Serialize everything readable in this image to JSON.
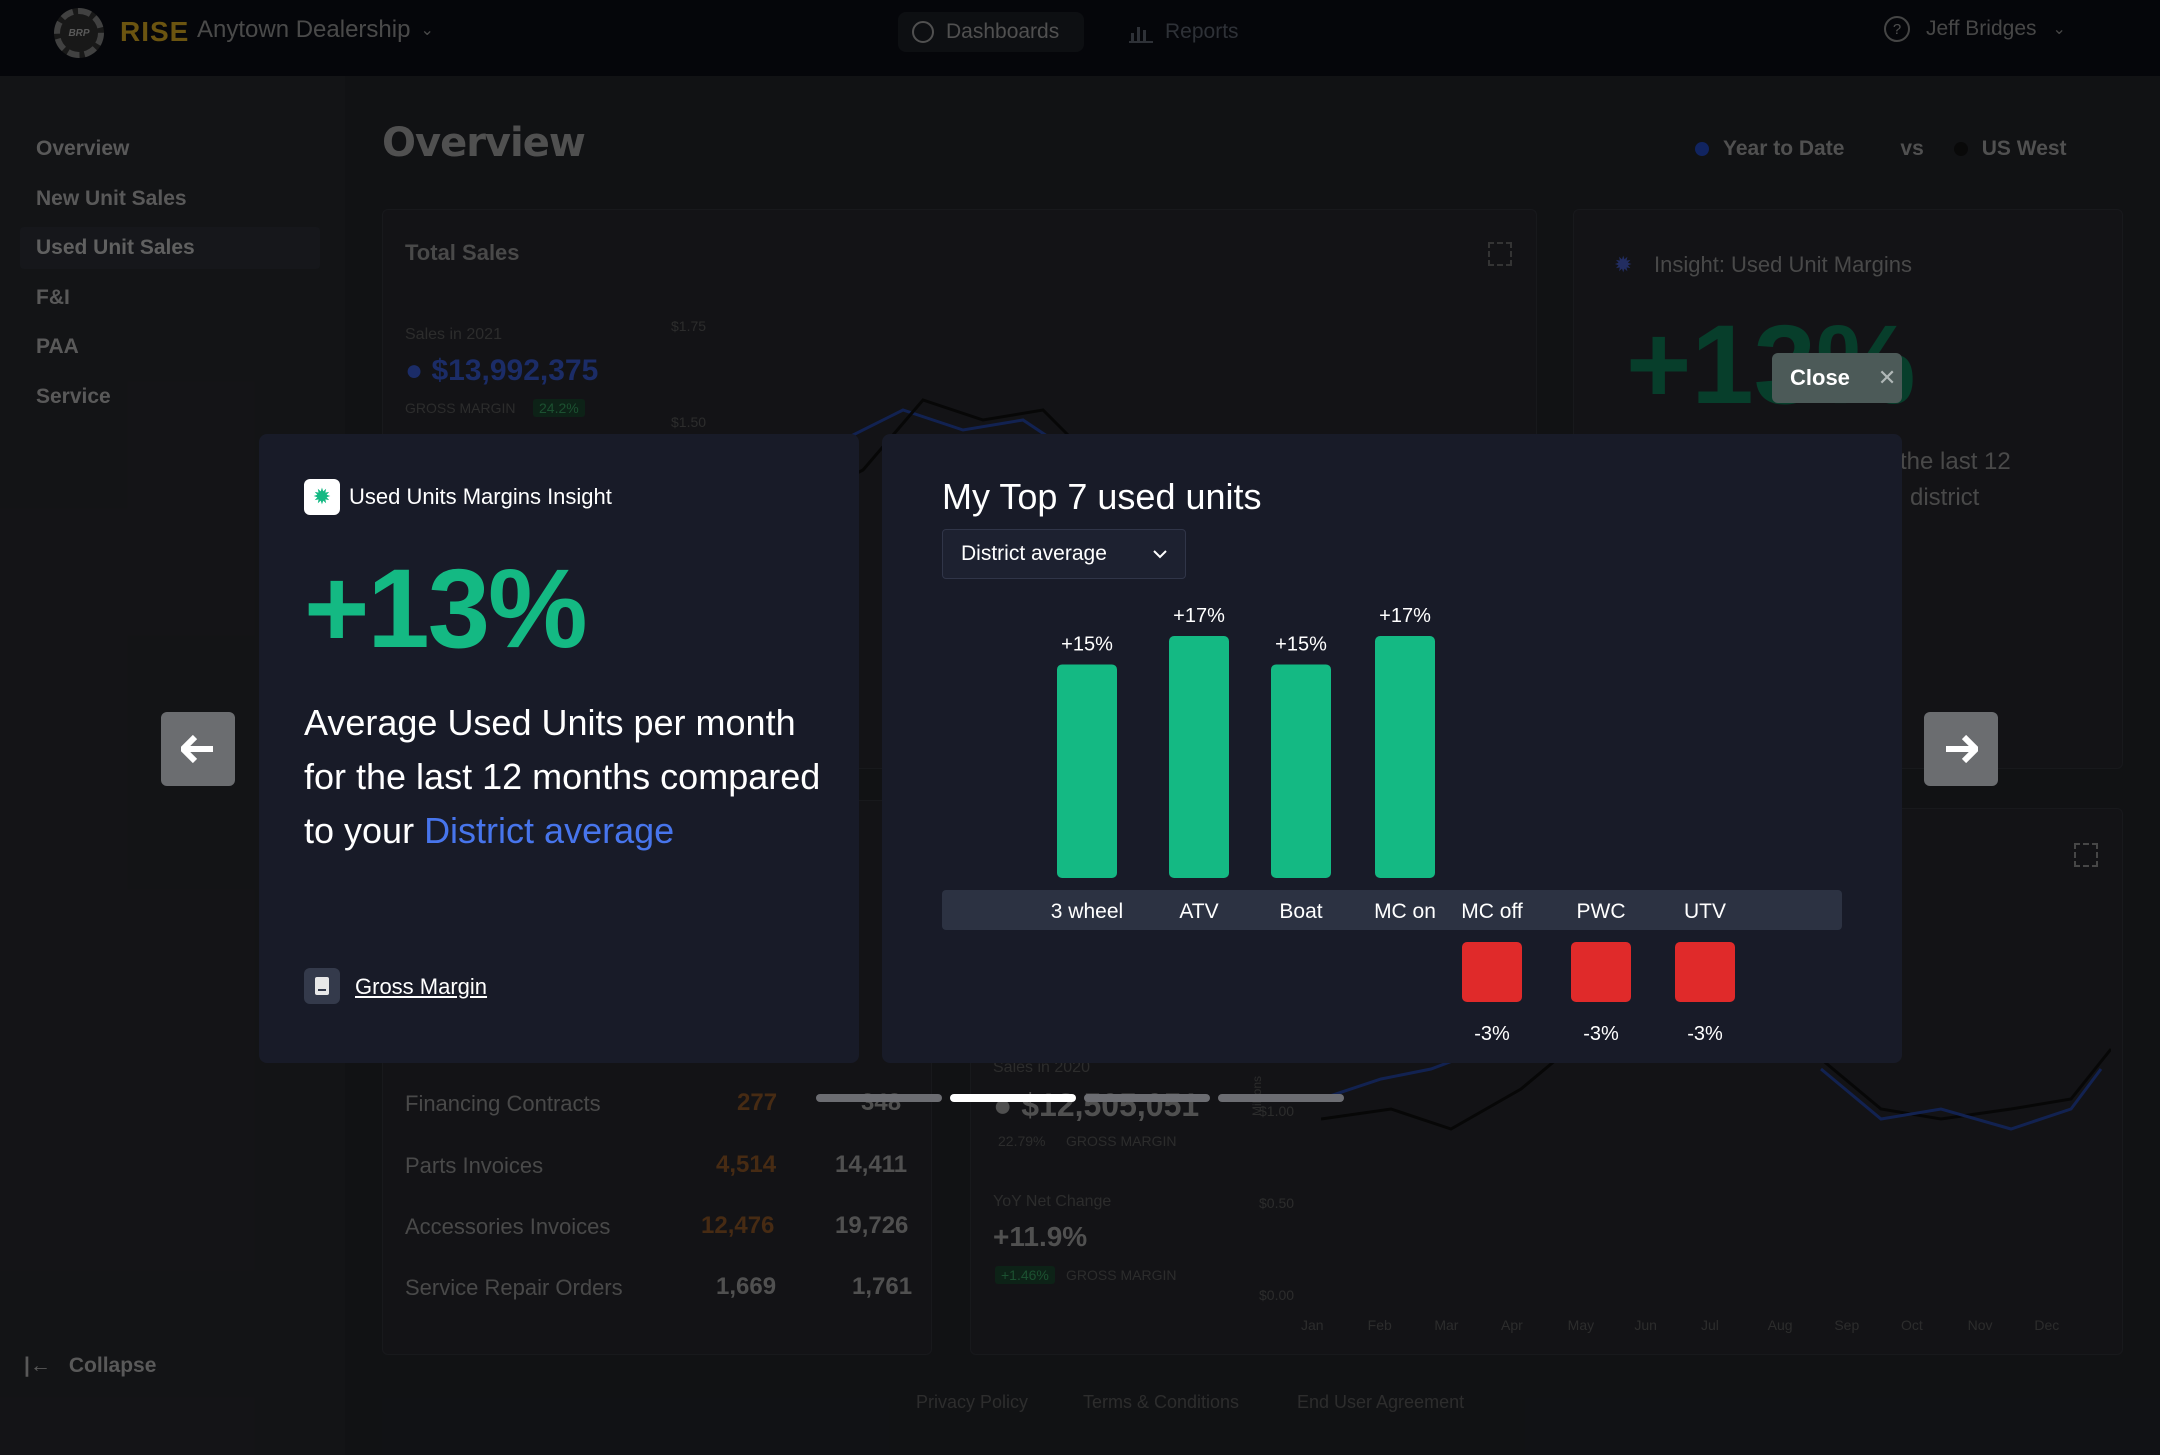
{
  "topbar": {
    "logo_badge": "BRP",
    "logo_text": "RISE",
    "dealership": "Anytown Dealership",
    "nav": [
      {
        "label": "Dashboards",
        "icon": "gauge-icon"
      },
      {
        "label": "Reports",
        "icon": "bar-chart-icon"
      }
    ],
    "user": "Jeff Bridges"
  },
  "sidebar": {
    "items": [
      {
        "label": "Overview",
        "active": false
      },
      {
        "label": "New Unit Sales",
        "active": false
      },
      {
        "label": "Used Unit Sales",
        "active": true
      },
      {
        "label": "F&I",
        "active": false
      },
      {
        "label": "PAA",
        "active": false
      },
      {
        "label": "Service",
        "active": false
      }
    ],
    "collapse_label": "Collapse"
  },
  "background": {
    "page_title": "Overview",
    "filter_a": "Year to Date",
    "filter_vs": "vs",
    "filter_b": "US West",
    "total_sales": {
      "title": "Total Sales",
      "sales_label": "Sales in 2021",
      "sales_value": "$13,992,375",
      "gm_label": "GROSS MARGIN",
      "gm_value": "24.2%",
      "y_ticks": [
        "$1.75",
        "$1.50"
      ]
    },
    "insight_card": {
      "title": "Insight: Used Unit Margins",
      "big": "+13%",
      "text_1": "the last 12",
      "text_2": "district"
    },
    "table": {
      "rows": [
        {
          "label": "Financing Contracts",
          "a": "277",
          "b": "348",
          "highlight": true
        },
        {
          "label": "Parts Invoices",
          "a": "4,514",
          "b": "14,411",
          "highlight": true
        },
        {
          "label": "Accessories Invoices",
          "a": "12,476",
          "b": "19,726",
          "highlight": true
        },
        {
          "label": "Service Repair Orders",
          "a": "1,669",
          "b": "1,761",
          "highlight": false
        }
      ]
    },
    "bottom_chart": {
      "sales_label": "Sales in 2020",
      "sales_value": "$12,505,051",
      "gm_value": "22.79%",
      "gm_label": "GROSS MARGIN",
      "yoy_label": "YoY Net Change",
      "yoy_value": "+11.9%",
      "yoy_gm": "+1.46%",
      "axis_label": "Millions",
      "y_ticks": [
        "$1.00",
        "$0.50",
        "$0.00"
      ],
      "months": [
        "Jan",
        "Feb",
        "Mar",
        "Apr",
        "May",
        "Jun",
        "Jul",
        "Aug",
        "Sep",
        "Oct",
        "Nov",
        "Dec"
      ]
    },
    "footer": [
      "Privacy Policy",
      "Terms & Conditions",
      "End User Agreement"
    ]
  },
  "modal": {
    "close_label": "Close",
    "insight": {
      "label": "Used Units Margins Insight",
      "big_value": "+13%",
      "body_prefix": "Average Used Units per month for the last 12 months compared to your ",
      "body_highlight": "District average",
      "link_label": "Gross Margin"
    },
    "chart_title": "My Top 7 used units",
    "select_value": "District average",
    "carousel": {
      "count": 4,
      "active_index": 1
    }
  },
  "chart_data": {
    "type": "bar",
    "title": "My Top 7 used units",
    "categories": [
      "3 wheel",
      "ATV",
      "Boat",
      "MC on",
      "MC off",
      "PWC",
      "UTV"
    ],
    "values": [
      15,
      17,
      15,
      17,
      -3,
      -3,
      -3
    ],
    "labels": [
      "+15%",
      "+17%",
      "+15%",
      "+17%",
      "-3%",
      "-3%",
      "-3%"
    ],
    "unit": "%",
    "colors": {
      "positive": "#14b983",
      "negative": "#e02a2a"
    }
  },
  "colors": {
    "accent_green": "#14b983",
    "accent_blue": "#4775ec",
    "negative_red": "#e02a2a",
    "panel_bg": "#181b28",
    "brand_gold": "#b9911d"
  }
}
